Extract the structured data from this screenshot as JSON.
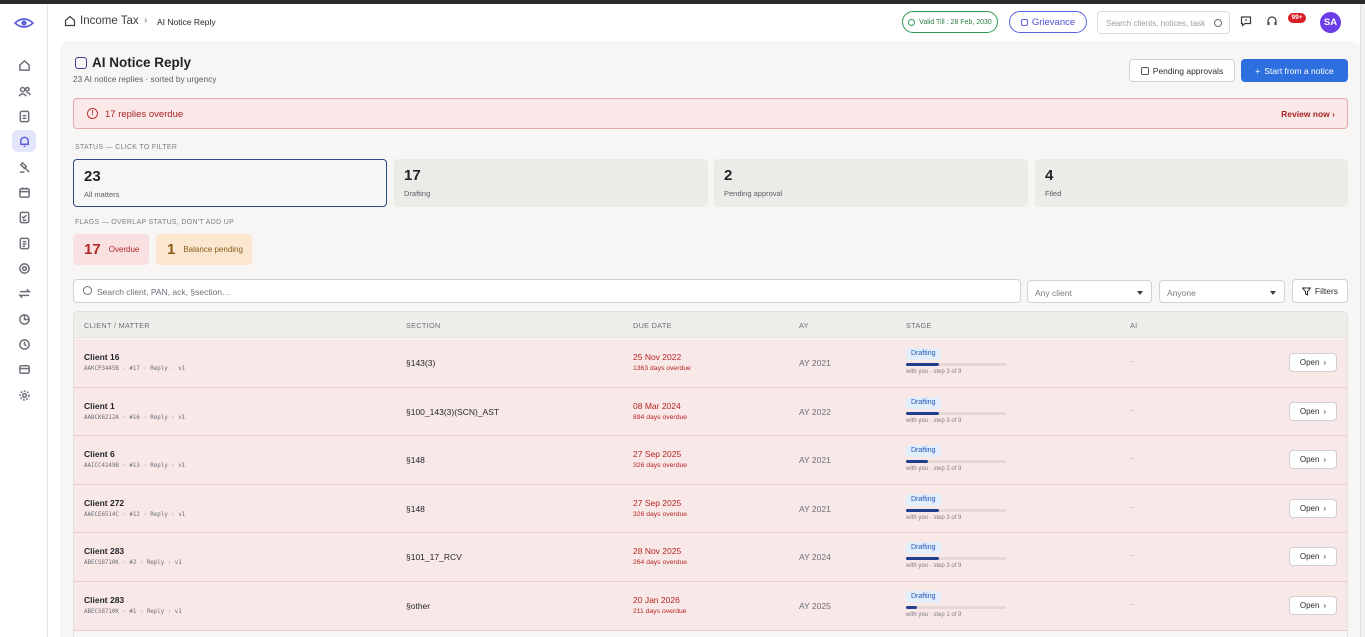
{
  "header": {
    "breadcrumb_root": "Income Tax",
    "breadcrumb_current": "AI Notice Reply",
    "valid_till": "Valid Till : 28 Feb, 2030",
    "grievance_label": "Grievance",
    "search_placeholder": "Search clients, notices, task",
    "notif_badge": "99+",
    "avatar_initials": "SA"
  },
  "sidebar": {
    "items": [
      {
        "icon": "home-icon",
        "active": false
      },
      {
        "icon": "users-icon",
        "active": false
      },
      {
        "icon": "document-icon",
        "active": false
      },
      {
        "icon": "bell-icon",
        "active": true
      },
      {
        "icon": "gavel-icon",
        "active": false
      },
      {
        "icon": "calendar-icon",
        "active": false
      },
      {
        "icon": "checklist-icon",
        "active": false
      },
      {
        "icon": "file-text-icon",
        "active": false
      },
      {
        "icon": "target-icon",
        "active": false
      },
      {
        "icon": "transfer-icon",
        "active": false
      },
      {
        "icon": "pie-chart-icon",
        "active": false
      },
      {
        "icon": "clock-icon",
        "active": false
      },
      {
        "icon": "invoice-icon",
        "active": false
      },
      {
        "icon": "settings-icon",
        "active": false
      }
    ]
  },
  "page": {
    "title": "AI Notice Reply",
    "subtitle": "23 AI notice replies · sorted by urgency",
    "pending_approvals_label": "Pending approvals",
    "start_label": "Start from a notice"
  },
  "alert": {
    "text": "17 replies overdue",
    "link": "Review now"
  },
  "status_label": "STATUS — CLICK TO FILTER",
  "stats": [
    {
      "num": "23",
      "label": "All matters"
    },
    {
      "num": "17",
      "label": "Drafting"
    },
    {
      "num": "2",
      "label": "Pending approval"
    },
    {
      "num": "4",
      "label": "Filed"
    }
  ],
  "flags_label": "FLAGS — OVERLAP STATUS, DON'T ADD UP",
  "flags": [
    {
      "num": "17",
      "label": "Overdue"
    },
    {
      "num": "1",
      "label": "Balance pending"
    }
  ],
  "filters": {
    "search_placeholder": "Search client, PAN, ack, §section…",
    "client_select": "Any client",
    "assignee_select": "Anyone",
    "filters_label": "Filters"
  },
  "table": {
    "headers": [
      "CLIENT / MATTER",
      "SECTION",
      "DUE DATE",
      "AY",
      "STAGE",
      "AI"
    ],
    "open_label": "Open",
    "rows": [
      {
        "client": "Client 16",
        "ref": "AAKCP3445B · #17 · Reply · v1",
        "section": "§143(3)",
        "due": "25 Nov 2022",
        "overdue": "1363 days overdue",
        "ay": "AY 2021",
        "stage": "Drafting",
        "progress": 0.33,
        "stage_text": "with you · step 3 of 9",
        "ai": "–"
      },
      {
        "client": "Client 1",
        "ref": "AABCK6212A · #16 · Reply · v1",
        "section": "§100_143(3)(SCN)_AST",
        "due": "08 Mar 2024",
        "overdue": "894 days overdue",
        "ay": "AY 2022",
        "stage": "Drafting",
        "progress": 0.33,
        "stage_text": "with you · step 3 of 9",
        "ai": "–"
      },
      {
        "client": "Client 6",
        "ref": "AAICC4149B · #13 · Reply · v1",
        "section": "§148",
        "due": "27 Sep 2025",
        "overdue": "326 days overdue",
        "ay": "AY 2021",
        "stage": "Drafting",
        "progress": 0.22,
        "stage_text": "with you · step 2 of 9",
        "ai": "–"
      },
      {
        "client": "Client 272",
        "ref": "AAECE6514C · #12 · Reply · v1",
        "section": "§148",
        "due": "27 Sep 2025",
        "overdue": "326 days overdue",
        "ay": "AY 2021",
        "stage": "Drafting",
        "progress": 0.33,
        "stage_text": "with you · step 3 of 9",
        "ai": "–"
      },
      {
        "client": "Client 283",
        "ref": "ABECS8710K · #2 · Reply · v1",
        "section": "§101_17_RCV",
        "due": "28 Nov 2025",
        "overdue": "264 days overdue",
        "ay": "AY 2024",
        "stage": "Drafting",
        "progress": 0.33,
        "stage_text": "with you · step 3 of 9",
        "ai": "–"
      },
      {
        "client": "Client 283",
        "ref": "ABECS8710K · #1 · Reply · v1",
        "section": "§other",
        "due": "20 Jan 2026",
        "overdue": "211 days overdue",
        "ay": "AY 2025",
        "stage": "Drafting",
        "progress": 0.11,
        "stage_text": "with you · step 1 of 9",
        "ai": "–"
      }
    ]
  }
}
